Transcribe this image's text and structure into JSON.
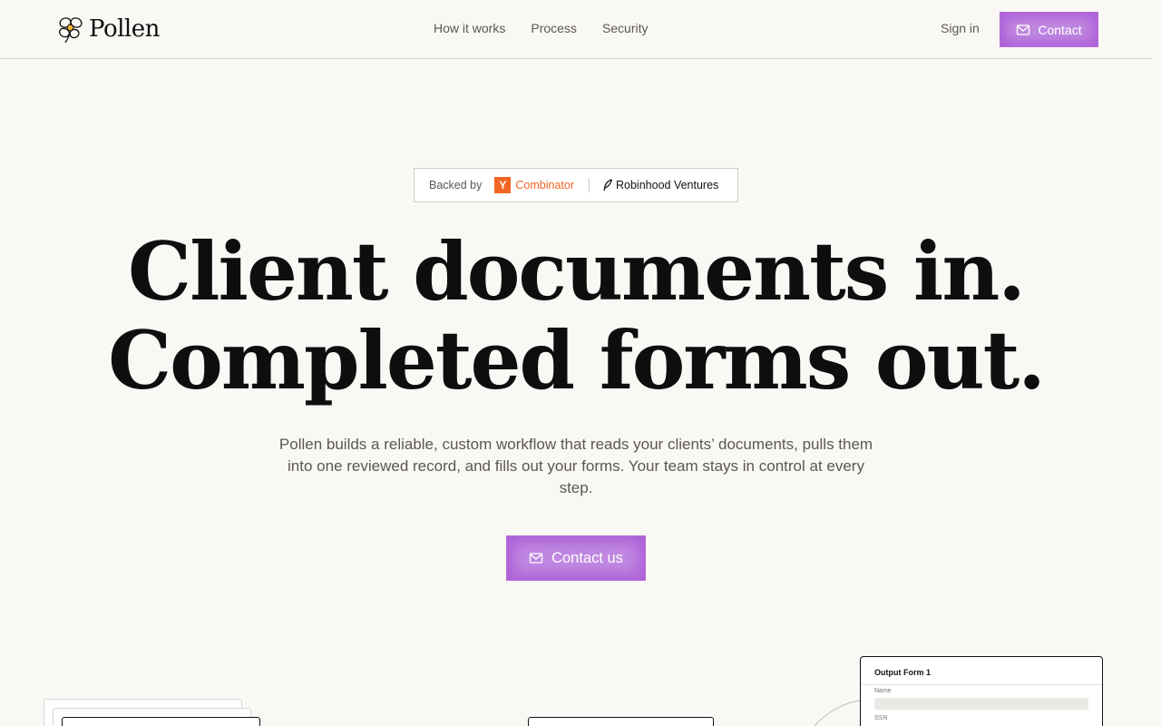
{
  "brand": {
    "name": "Pollen",
    "logo_icon": "flower-icon"
  },
  "nav": {
    "links": [
      "How it works",
      "Process",
      "Security"
    ],
    "sign_in": "Sign in",
    "contact": "Contact",
    "contact_icon": "mail-icon"
  },
  "badge": {
    "label": "Backed by",
    "yc_mark": "Y",
    "yc_name": "Combinator",
    "rh_name": "Robinhood Ventures"
  },
  "hero": {
    "title_line1": "Client documents in.",
    "title_line2": "Completed forms out.",
    "subtitle": "Pollen builds a reliable, custom workflow that reads your clients’ documents, pulls them into one reviewed record, and fills out your forms. Your team stays in control at every step.",
    "cta": "Contact us"
  },
  "preview": {
    "output_form": {
      "title": "Output Form 1",
      "fields": [
        "Name",
        "SSN"
      ]
    }
  },
  "colors": {
    "accent": "#c08ae0",
    "accent_border": "#b46ad6",
    "yc_orange": "#f26522",
    "background": "#faf8f5"
  }
}
